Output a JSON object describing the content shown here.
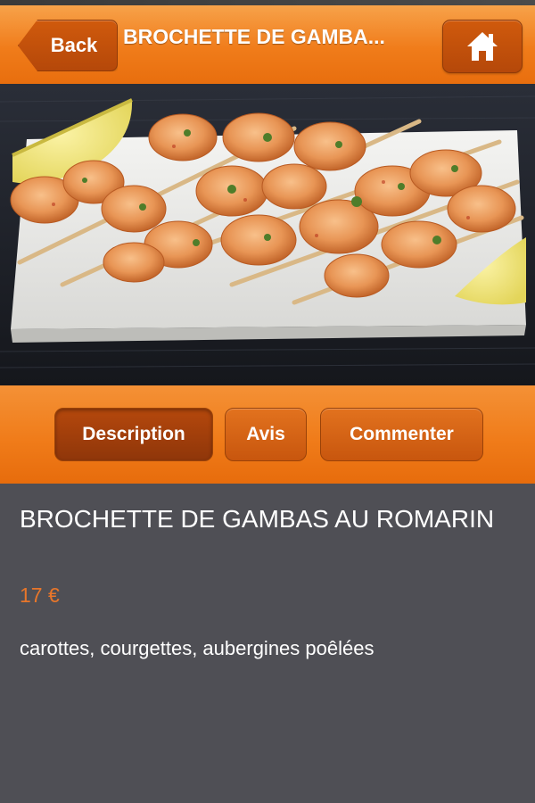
{
  "header": {
    "back_label": "Back",
    "title": "BROCHETTE DE GAMBA...",
    "home_icon": "home-icon"
  },
  "photo": {
    "subject": "shrimp-skewers-photo"
  },
  "tabs": [
    {
      "label": "Description",
      "active": true
    },
    {
      "label": "Avis",
      "active": false
    },
    {
      "label": "Commenter",
      "active": false
    }
  ],
  "dish": {
    "title": "BROCHETTE DE GAMBAS AU ROMARIN",
    "price": "17 €",
    "description": "carottes, courgettes, aubergines poêlées"
  },
  "colors": {
    "accent": "#f07c1a",
    "accent_dark": "#b5480a",
    "price": "#e8762a",
    "content_bg": "#4f4f55"
  }
}
